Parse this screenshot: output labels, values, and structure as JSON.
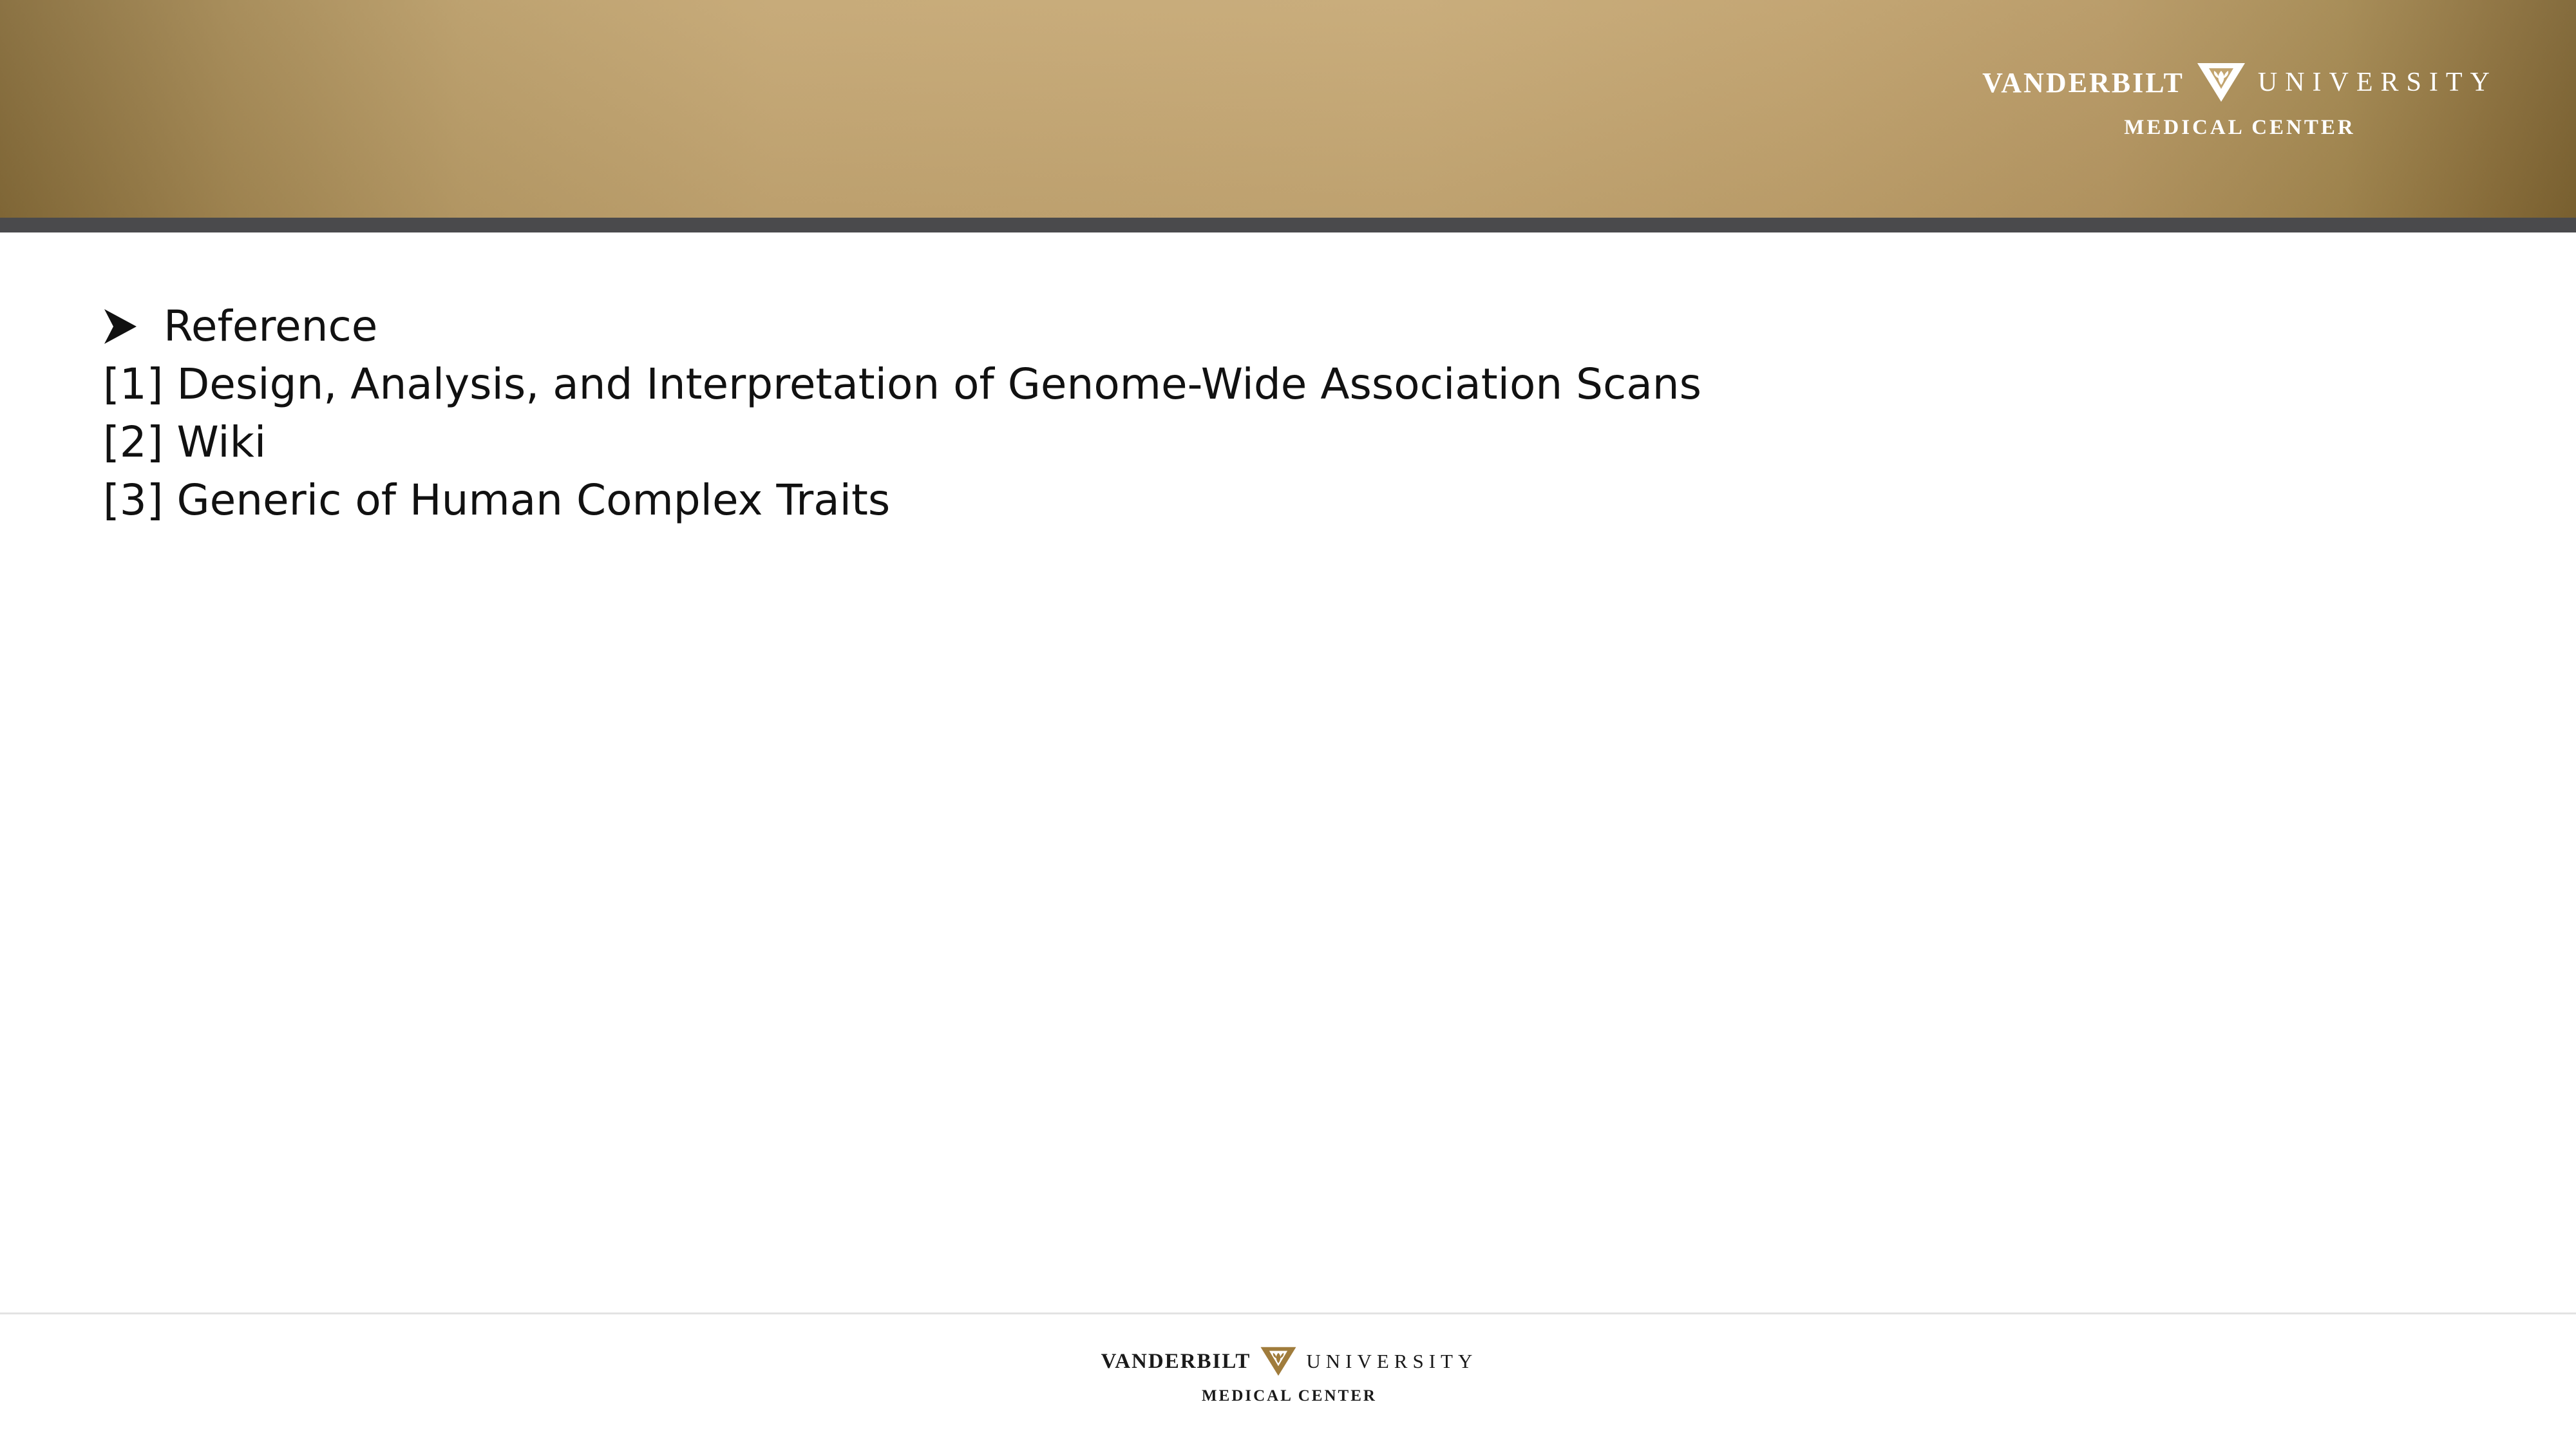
{
  "header": {
    "logo": {
      "word1": "VANDERBILT",
      "word2": "UNIVERSITY",
      "line2": "MEDICAL CENTER"
    }
  },
  "content": {
    "bullet_heading": "Reference",
    "references": [
      "[1] Design, Analysis, and Interpretation of Genome-Wide Association Scans",
      "[2] Wiki",
      "[3] Generic of Human Complex Traits"
    ]
  },
  "footer": {
    "logo": {
      "word1": "VANDERBILT",
      "word2": "UNIVERSITY",
      "line2": "MEDICAL CENTER"
    }
  },
  "colors": {
    "header_gold": "#c4a672",
    "header_rule": "#4a4a4c",
    "logo_gold": "#a07c3c",
    "text": "#111111"
  },
  "icons": {
    "bullet": "arrowhead-bullet-icon",
    "logo": "vanderbilt-v-oak-leaf-icon"
  }
}
